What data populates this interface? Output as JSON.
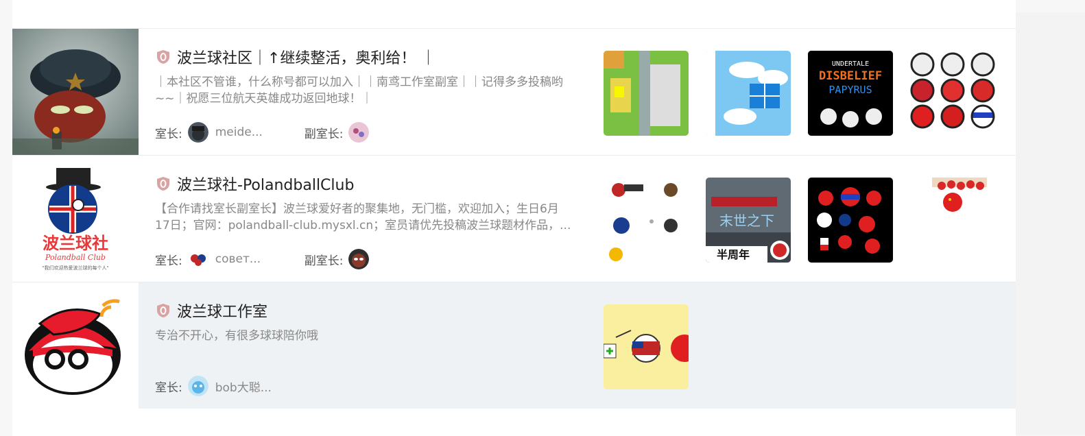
{
  "communities": [
    {
      "title": "波兰球社区｜↑继续整活，奥利给！ ｜",
      "description": "｜本社区不管谁，什么称号都可以加入｜｜南鸢工作室副室｜｜记得多多投稿哟~~｜祝愿三位航天英雄成功返回地球！｜",
      "owner_label": "室长:",
      "owner_name": "meide...",
      "vice_label": "副室长:",
      "cover_icon": "fur-hat-ball-cover",
      "thumb_text": [
        "UNDERTALE",
        "DISBELIEF",
        "PAPYRUS"
      ]
    },
    {
      "title": "波兰球社-PolandballClub",
      "description": "【合作请找室长副室长】波兰球爱好者的聚集地，无门槛，欢迎加入；生日6月17日；官网：polandball-club.mysxl.cn；室员请优先投稿波兰球题材作品，...",
      "owner_label": "室长:",
      "owner_name": "совет...",
      "vice_label": "副室长:",
      "cover_title": "波兰球社",
      "cover_sub": "Polandball Club",
      "cover_caption": "\"我们欢迎热爱波兰球的每个人\"",
      "thumb_text": [
        "末世之下",
        "半周年"
      ]
    },
    {
      "title": "波兰球工作室",
      "description": "专治不开心，有很多球球陪你哦",
      "owner_label": "室长:",
      "owner_name": "bob大聪..."
    }
  ],
  "colors": {
    "accent_red": "#e63a3a",
    "hover_row": "#eef2f5",
    "shield": "#d9a3a3"
  }
}
